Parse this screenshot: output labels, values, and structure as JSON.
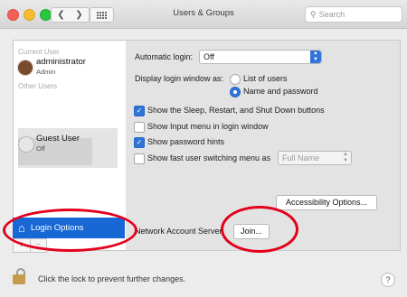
{
  "window": {
    "title": "Users & Groups",
    "search_placeholder": "Search"
  },
  "sidebar": {
    "current_user_heading": "Current User",
    "current_user": {
      "name": "administrator",
      "role": "Admin"
    },
    "other_users_heading": "Other Users",
    "guest_user": {
      "name": "Guest User",
      "status": "Off"
    },
    "login_options_label": "Login Options",
    "add_label": "+",
    "remove_label": "−"
  },
  "settings": {
    "automatic_login_label": "Automatic login:",
    "automatic_login_value": "Off",
    "display_login_label": "Display login window as:",
    "display_options": [
      {
        "label": "List of users",
        "selected": false
      },
      {
        "label": "Name and password",
        "selected": true
      }
    ],
    "checkboxes": [
      {
        "label": "Show the Sleep, Restart, and Shut Down buttons",
        "checked": true
      },
      {
        "label": "Show Input menu in login window",
        "checked": false
      },
      {
        "label": "Show password hints",
        "checked": true
      },
      {
        "label": "Show fast user switching menu as",
        "checked": false
      }
    ],
    "fast_switch_value": "Full Name",
    "accessibility_button": "Accessibility Options...",
    "network_label": "Network Account Server:",
    "join_button": "Join..."
  },
  "footer": {
    "lock_text": "Click the lock to prevent further changes.",
    "help_label": "?"
  },
  "colors": {
    "accent": "#2f74d8",
    "selection": "#1767d4",
    "annotation_ring": "#e3001b"
  },
  "icons": [
    "close-icon",
    "minimize-icon",
    "zoom-icon",
    "back-icon",
    "forward-icon",
    "grid-icon",
    "search-icon",
    "house-icon",
    "lock-icon",
    "help-icon"
  ]
}
